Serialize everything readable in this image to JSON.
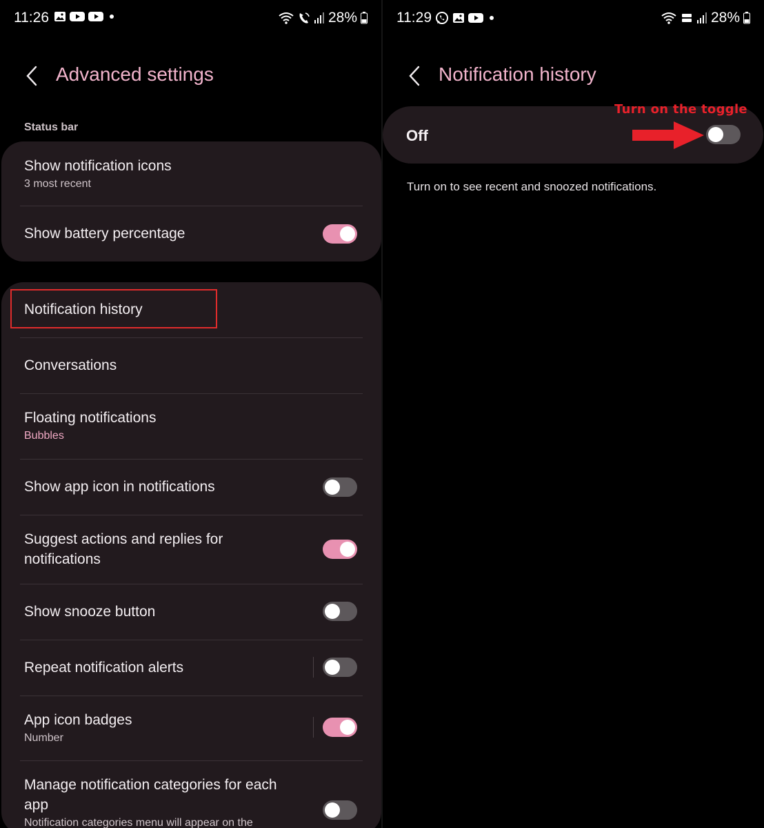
{
  "left_screen": {
    "status_bar": {
      "time": "11:26",
      "battery": "28%"
    },
    "header": {
      "title": "Advanced settings"
    },
    "section_status_bar": "Status bar",
    "status_card": {
      "show_notification_icons": {
        "title": "Show notification icons",
        "subtitle": "3 most recent"
      },
      "show_battery_percentage": {
        "title": "Show battery percentage",
        "toggle_on": true
      }
    },
    "notif_card": {
      "notification_history": {
        "title": "Notification history"
      },
      "conversations": {
        "title": "Conversations"
      },
      "floating_notifications": {
        "title": "Floating notifications",
        "subtitle": "Bubbles"
      },
      "show_app_icon": {
        "title": "Show app icon in notifications",
        "toggle_on": false
      },
      "suggest_actions": {
        "title_line1": "Suggest actions and replies for",
        "title_line2": "notifications",
        "toggle_on": true
      },
      "show_snooze": {
        "title": "Show snooze button",
        "toggle_on": false
      },
      "repeat_alerts": {
        "title": "Repeat notification alerts",
        "toggle_on": false
      },
      "app_icon_badges": {
        "title": "App icon badges",
        "subtitle": "Number",
        "toggle_on": true
      },
      "manage_categories": {
        "title_line1": "Manage notification categories for each",
        "title_line2": "app",
        "subtitle": "Notification categories menu will appear on the",
        "toggle_on": false
      }
    }
  },
  "right_screen": {
    "status_bar": {
      "time": "11:29",
      "battery": "28%"
    },
    "header": {
      "title": "Notification history"
    },
    "master_switch": {
      "label": "Off",
      "toggle_on": false
    },
    "description": "Turn on to see recent and snoozed notifications.",
    "annotation": {
      "text": "Turn on the toggle"
    }
  },
  "colors": {
    "accent_pink": "#f2b4cc",
    "toggle_on": "#e891b1",
    "toggle_off": "#5d585b",
    "card_bg": "#221a1e",
    "annotation_red": "#e02c2c"
  }
}
